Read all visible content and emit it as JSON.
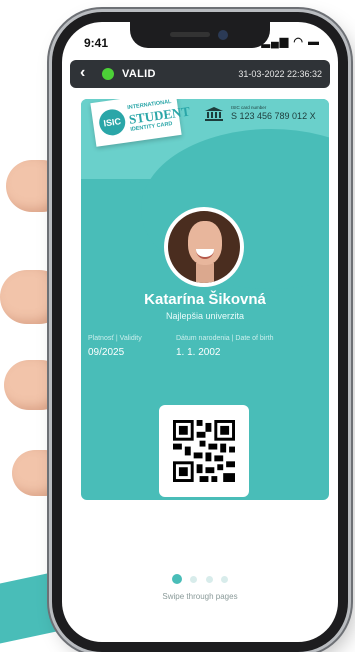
{
  "status_bar": {
    "time": "9:41",
    "icons": [
      "signal-icon",
      "wifi-icon",
      "battery-icon"
    ]
  },
  "topbar": {
    "back_icon": "chevron-left-icon",
    "status_label": "VALID",
    "status_color": "#4cd137",
    "datetime": "31-03-2022 22:36:32"
  },
  "card": {
    "logo": {
      "badge": "ISIC",
      "line1": "INTERNATIONAL",
      "line2": "STUDENT",
      "line3": "IDENTITY CARD"
    },
    "card_number_label": "ISIC card number",
    "card_number": "S 123 456 789 012 X",
    "name": "Katarína Šikovná",
    "university": "Najlepšia univerzita",
    "validity_label": "Platnosť | Validity",
    "validity": "09/2025",
    "dob_label": "Dátum narodenia | Date of birth",
    "dob": "1. 1. 2002",
    "accent_color": "#49bdb8"
  },
  "pager": {
    "pages": 4,
    "active": 0
  },
  "swipe_hint": "Swipe through pages"
}
